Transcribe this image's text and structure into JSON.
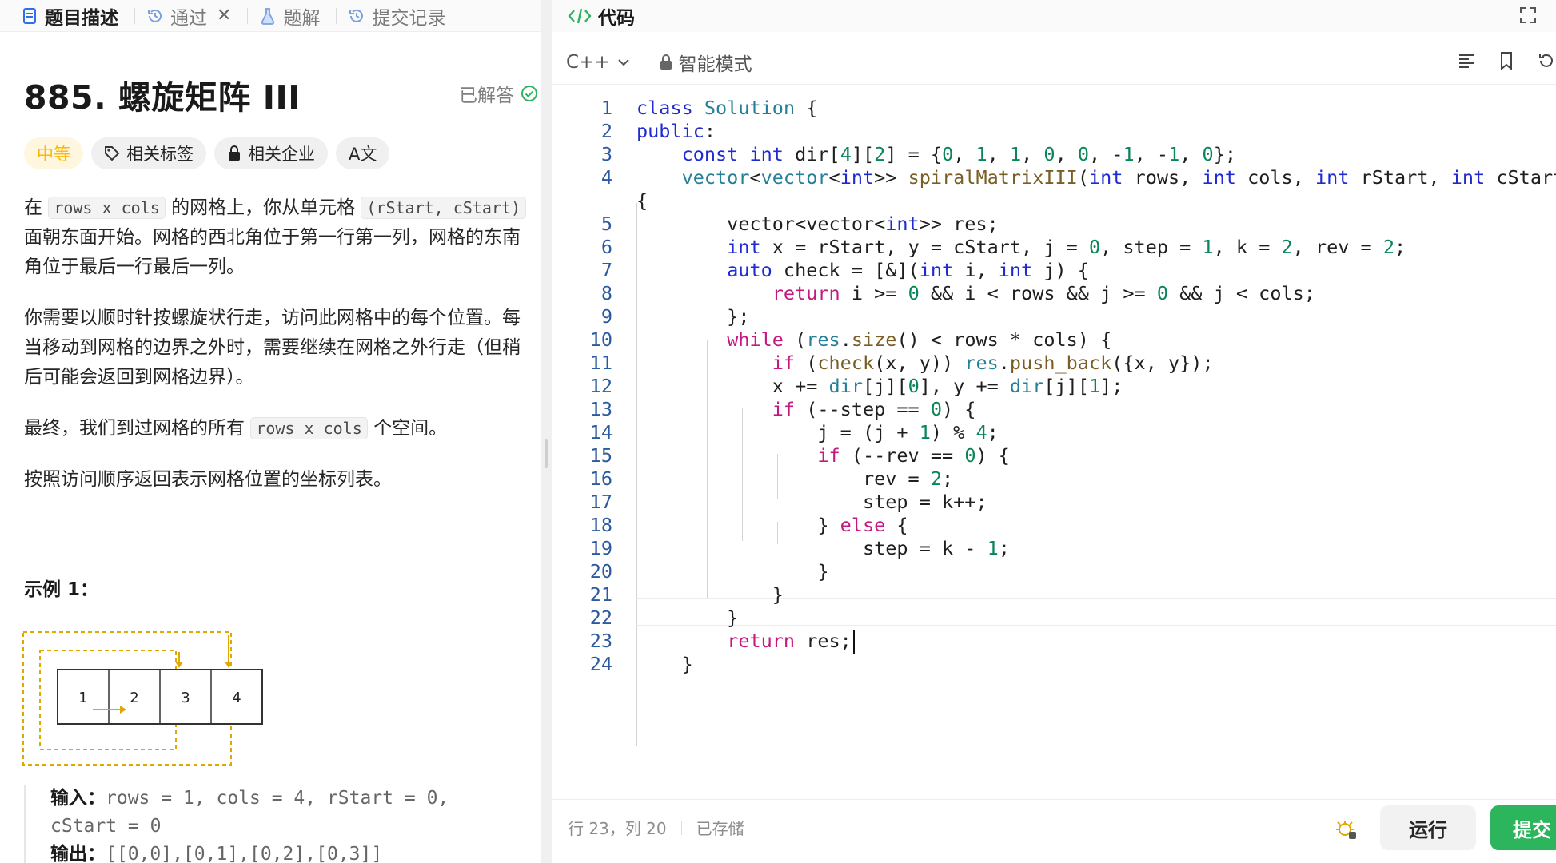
{
  "tabs": {
    "description": "题目描述",
    "accepted": "通过",
    "solutions": "题解",
    "submissions": "提交记录"
  },
  "problem": {
    "title": "885. 螺旋矩阵 III",
    "status": "已解答",
    "difficulty": "中等",
    "tag_topics": "相关标签",
    "tag_companies": "相关企业",
    "translate": "A文",
    "p1": {
      "a": "在 ",
      "code1": "rows x cols",
      "b": " 的网格上，你从单元格 ",
      "code2": "(rStart, cStart)",
      "c": " 面朝东面开始。网格的西北角位于第一行第一列，网格的东南角位于最后一行最后一列。"
    },
    "p2": "你需要以顺时针按螺旋状行走，访问此网格中的每个位置。每当移动到网格的边界之外时，需要继续在网格之外行走（但稍后可能会返回到网格边界）。",
    "p3": {
      "a": "最终，我们到过网格的所有 ",
      "code": "rows x cols",
      "b": " 个空间。"
    },
    "p4": "按照访问顺序返回表示网格位置的坐标列表。",
    "example_title": "示例 1：",
    "grid_cells": [
      "1",
      "2",
      "3",
      "4"
    ],
    "input_label": "输入：",
    "input_value": "rows = 1, cols = 4, rStart = 0,",
    "input_value2": "cStart = 0",
    "output_label": "输出：",
    "output_value": "[[0,0],[0,1],[0,2],[0,3]]"
  },
  "editor": {
    "header_title": "代码",
    "language": "C++",
    "mode": "智能模式",
    "cursor_pos": "行 23，列 20",
    "saved": "已存储",
    "run": "运行",
    "submit": "提交"
  },
  "code_lines": [
    {
      "n": "1"
    },
    {
      "n": "2"
    },
    {
      "n": "3"
    },
    {
      "n": "4"
    },
    {
      "n": "5"
    },
    {
      "n": "6"
    },
    {
      "n": "7"
    },
    {
      "n": "8"
    },
    {
      "n": "9"
    },
    {
      "n": "10"
    },
    {
      "n": "11"
    },
    {
      "n": "12"
    },
    {
      "n": "13"
    },
    {
      "n": "14"
    },
    {
      "n": "15"
    },
    {
      "n": "16"
    },
    {
      "n": "17"
    },
    {
      "n": "18"
    },
    {
      "n": "19"
    },
    {
      "n": "20"
    },
    {
      "n": "21"
    },
    {
      "n": "22"
    },
    {
      "n": "23"
    },
    {
      "n": "24"
    }
  ],
  "colors": {
    "accent_green": "#2db55d",
    "difficulty": "#ffb800",
    "keyword": "#1f2bd0",
    "number": "#098658"
  }
}
